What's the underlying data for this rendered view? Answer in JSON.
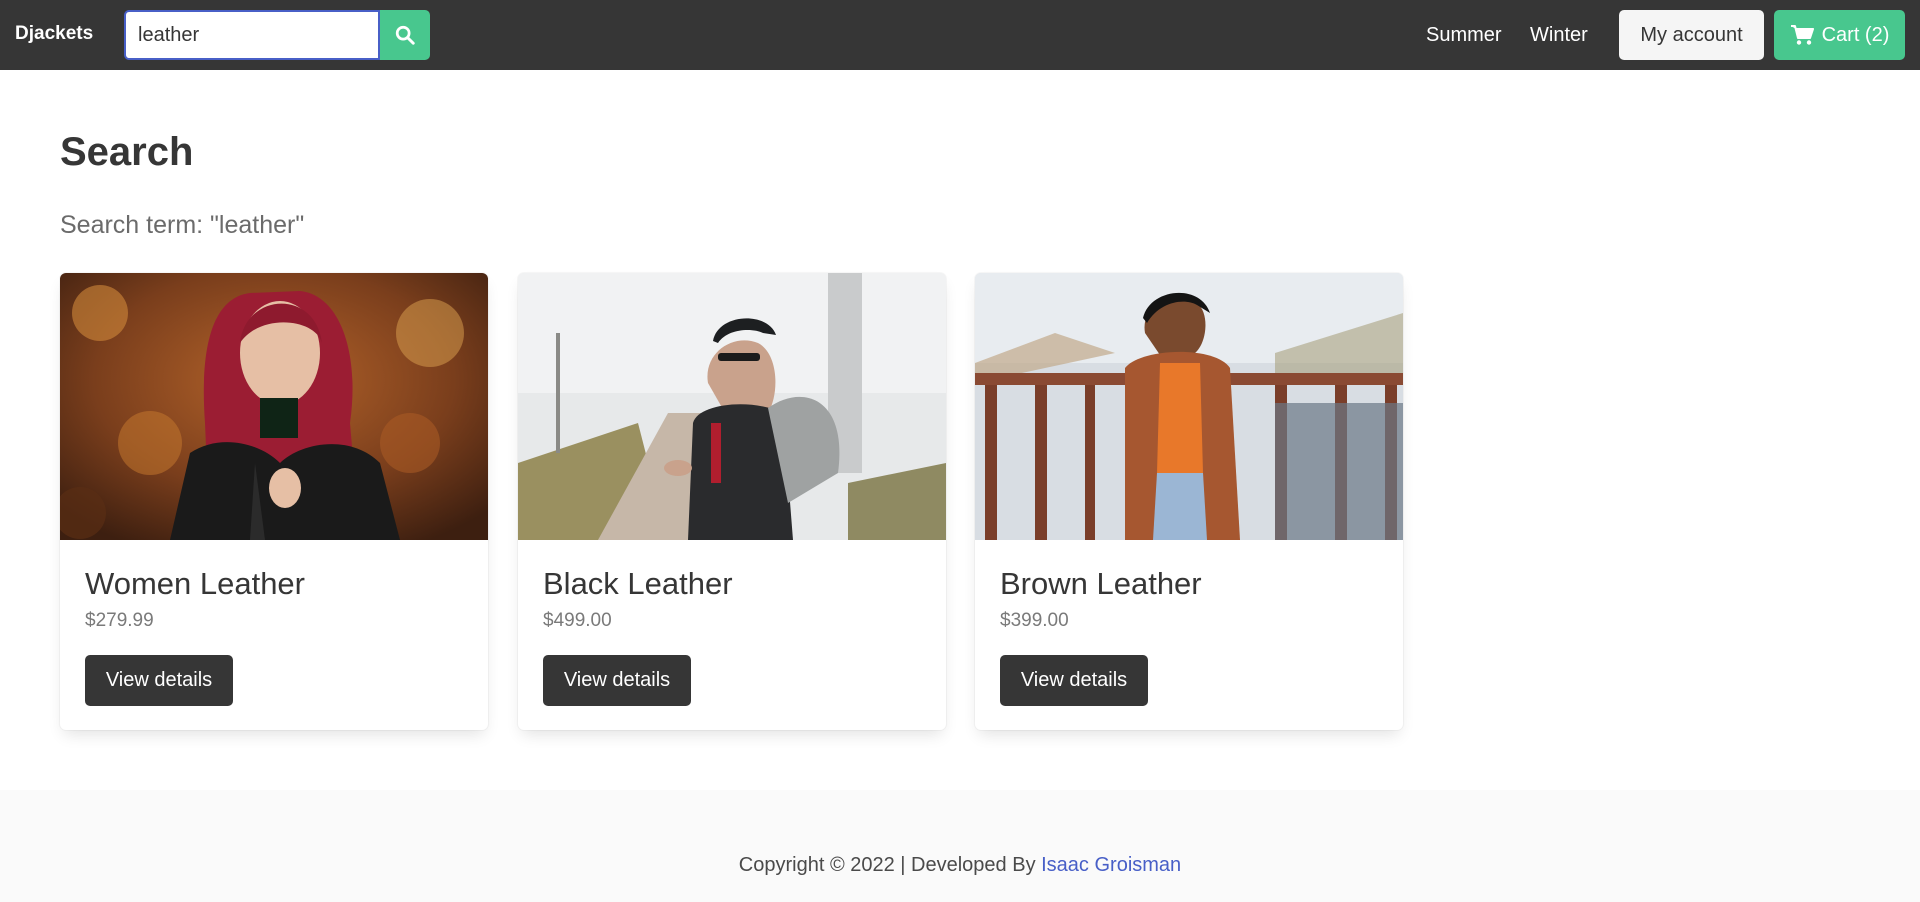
{
  "navbar": {
    "brand": "Djackets",
    "search": {
      "value": "leather"
    },
    "links": [
      "Summer",
      "Winter"
    ],
    "account_label": "My account",
    "cart_label": "Cart (2)"
  },
  "main": {
    "title": "Search",
    "subtitle": "Search term: \"leather\""
  },
  "products": [
    {
      "name": "Women Leather",
      "price": "$279.99",
      "button": "View details"
    },
    {
      "name": "Black Leather",
      "price": "$499.00",
      "button": "View details"
    },
    {
      "name": "Brown Leather",
      "price": "$399.00",
      "button": "View details"
    }
  ],
  "footer": {
    "text": "Copyright © 2022 | Developed By ",
    "link": "Isaac Groisman"
  },
  "colors": {
    "navbar": "#363636",
    "primary": "#48c78e",
    "link": "#485fc7",
    "dark_button": "#363636"
  },
  "icons": {
    "search_button": "search-icon",
    "cart_button": "shopping-cart-icon"
  }
}
